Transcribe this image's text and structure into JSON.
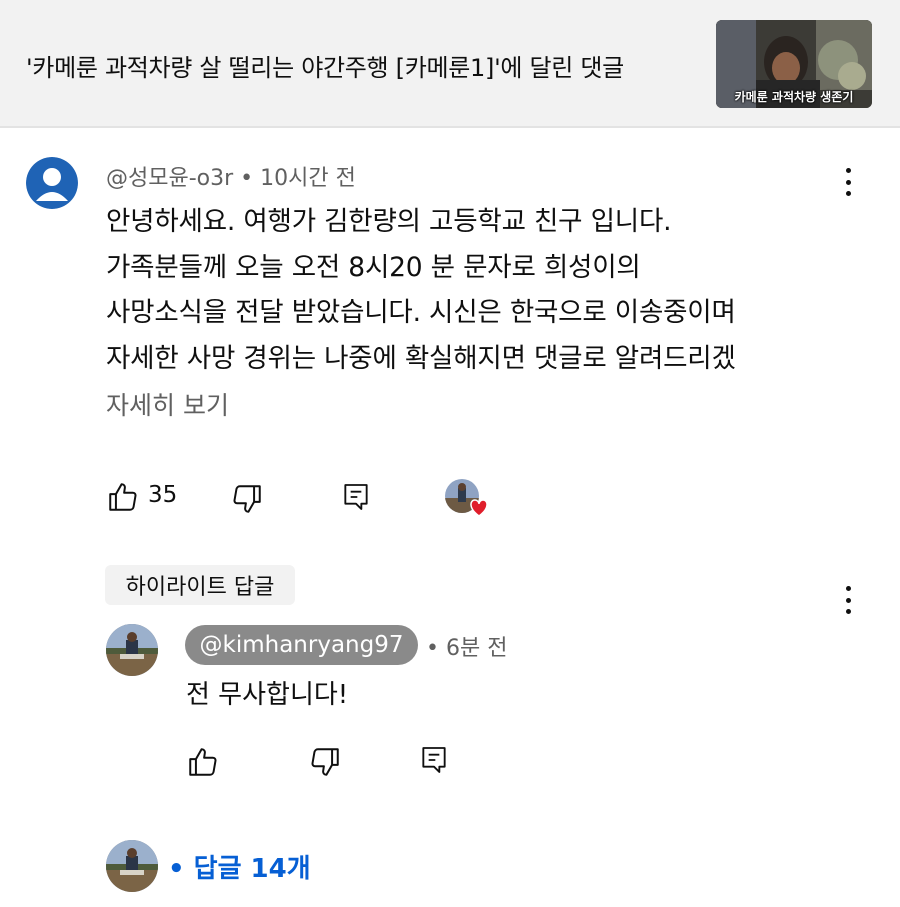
{
  "header": {
    "title": "'카메룬 과적차량 살 떨리는 야간주행 [카메룬1]'에 달린 댓글",
    "thumbnail_caption": "카메룬 과적차량 생존기"
  },
  "comment": {
    "author": "@성모윤-o3r",
    "time": "10시간 전",
    "lines": [
      "안녕하세요. 여행가 김한량의 고등학교 친구 입니다.",
      "가족분들께 오늘 오전 8시20 분 문자로 희성이의",
      "사망소식을 전달 받았습니다. 시신은 한국으로 이송중이며",
      "자세한 사망 경위는 나중에 확실해지면 댓글로 알려드리겠"
    ],
    "read_more": "자세히 보기",
    "likes": "35"
  },
  "highlight": {
    "label": "하이라이트 답글"
  },
  "reply": {
    "handle": "@kimhanryang97",
    "time": "• 6분 전",
    "text": "전 무사합니다!"
  },
  "replies": {
    "label": "• 답글 14개"
  },
  "colors": {
    "link": "#065fd4",
    "heart": "#e01e2b",
    "secondary_text": "#606060",
    "pill_bg": "#8a8a8a"
  },
  "icons": [
    "like-icon",
    "dislike-icon",
    "reply-icon",
    "more-vert-icon",
    "heart-icon",
    "default-avatar-icon"
  ]
}
